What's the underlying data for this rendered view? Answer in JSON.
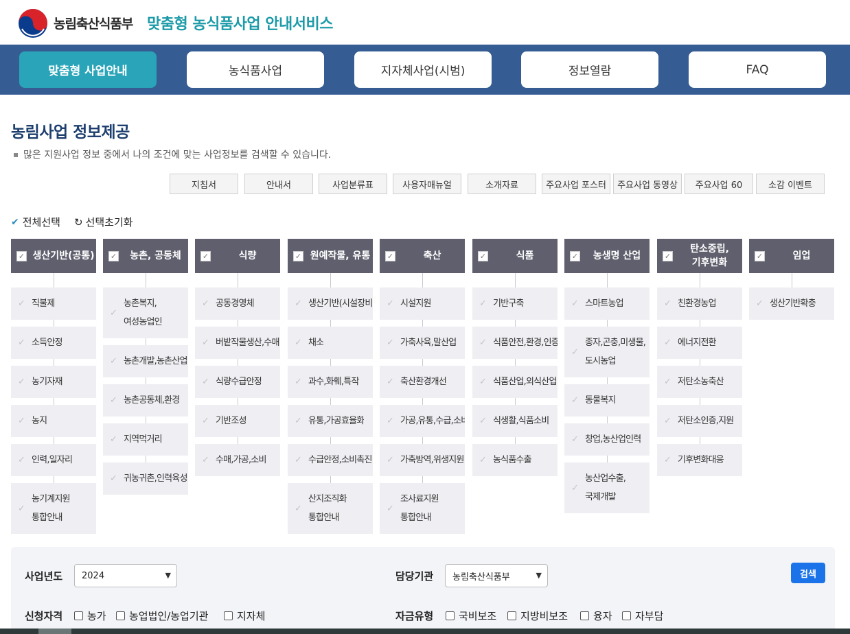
{
  "header": {
    "ministry": "농림축산식품부",
    "service_title": "맞춤형 농식품사업 안내서비스"
  },
  "nav": [
    {
      "label": "맞춤형 사업안내",
      "active": true
    },
    {
      "label": "농식품사업"
    },
    {
      "label": "지자체사업(시범)"
    },
    {
      "label": "정보열람"
    },
    {
      "label": "FAQ"
    }
  ],
  "page": {
    "title": "농림사업 정보제공",
    "desc": "많은 지원사업 정보 중에서 나의 조건에 맞는 사업정보를 검색할 수 있습니다."
  },
  "resources": [
    "지침서",
    "안내서",
    "사업분류표",
    "사용자매뉴얼",
    "소개자료",
    "주요사업 포스터",
    "주요사업 동영상",
    "주요사업 60",
    "소감 이벤트"
  ],
  "select": {
    "all_label": "전체선택",
    "reset_label": "선택초기화"
  },
  "categories": [
    {
      "name": "생산기반(공통)",
      "items": [
        "직불제",
        "소득안정",
        "농기자재",
        "농지",
        "인력,일자리",
        "농기계지원\n통합안내"
      ]
    },
    {
      "name": "농촌, 공동체",
      "items": [
        "농촌복지,\n여성농업인",
        "농촌개발,농촌산업",
        "농촌공동체,환경",
        "지역먹거리",
        "귀농귀촌,인력육성"
      ]
    },
    {
      "name": "식량",
      "items": [
        "공동경영체",
        "버밭작물생산,수매",
        "식량수급안정",
        "기반조성",
        "수매,가공,소비"
      ]
    },
    {
      "name": "원예작물, 유통",
      "items": [
        "생산기반(시설장비)",
        "채소",
        "과수,화훼,특작",
        "유통,가공효율화",
        "수급안정,소비촉진",
        "산지조직화\n통합안내"
      ]
    },
    {
      "name": "축산",
      "items": [
        "시설지원",
        "가축사육,말산업",
        "축산환경개선",
        "가공,유통,수급,소비",
        "가축방역,위생지원",
        "조사료지원\n통합안내"
      ]
    },
    {
      "name": "식품",
      "items": [
        "기반구축",
        "식품안전,환경,인증",
        "식품산업,외식산업",
        "식생활,식품소비",
        "농식품수출"
      ]
    },
    {
      "name": "농생명 산업",
      "items": [
        "스마트농업",
        "종자,곤충,미생물,\n도시농업",
        "동물복지",
        "창업,농산업인력",
        "농산업수출,\n국제개발"
      ]
    },
    {
      "name": "탄소중립,\n기후변화",
      "items": [
        "친환경농업",
        "에너지전환",
        "저탄소농축산",
        "저탄소인증,지원",
        "기후변화대응"
      ]
    },
    {
      "name": "임업",
      "items": [
        "생산기반확충"
      ]
    }
  ],
  "search": {
    "year_label": "사업년도",
    "year_value": "2024",
    "agency_label": "담당기관",
    "agency_value": "농림축산식품부",
    "button": "검색",
    "qualification_label": "신청자격",
    "qualification_options": [
      "농가",
      "농업법인/농업기관",
      "지자체"
    ],
    "fund_label": "자금유형",
    "fund_options": [
      "국비보조",
      "지방비보조",
      "융자",
      "자부담"
    ]
  }
}
